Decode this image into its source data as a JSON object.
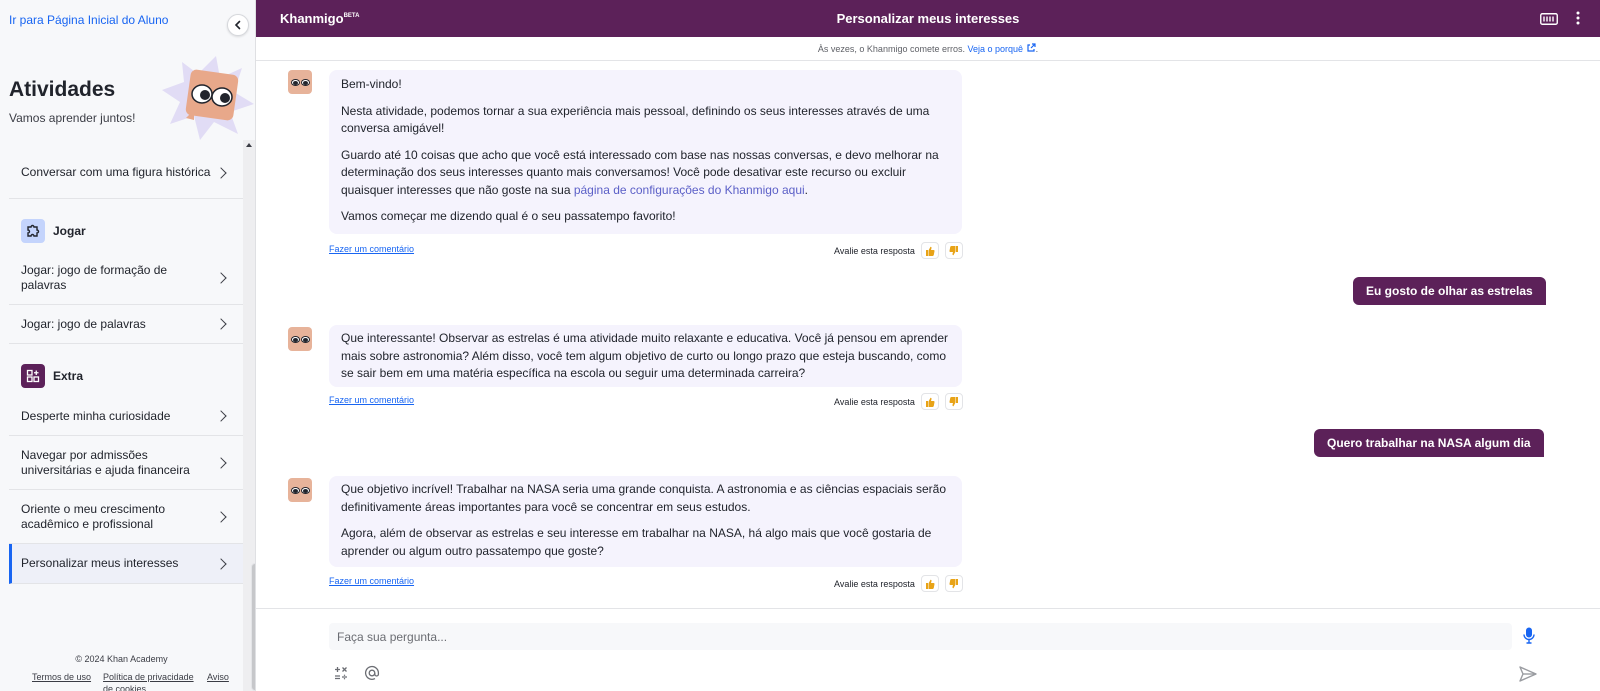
{
  "sidebar": {
    "back_link": "Ir para Página Inicial do Aluno",
    "title": "Atividades",
    "subtitle": "Vamos aprender juntos!",
    "items": [
      {
        "label": "Conversar com uma figura histórica"
      },
      {
        "label": "Jogar: jogo de formação de palavras"
      },
      {
        "label": "Jogar: jogo de palavras"
      },
      {
        "label": "Desperte minha curiosidade"
      },
      {
        "label": "Navegar por admissões universitárias e ajuda financeira"
      },
      {
        "label": "Oriente o meu crescimento acadêmico e profissional"
      },
      {
        "label": "Personalizar meus interesses",
        "active": true
      }
    ],
    "sections": {
      "play": "Jogar",
      "extra": "Extra"
    },
    "footer": {
      "copyright": "© 2024 Khan Academy",
      "terms": "Termos de uso",
      "privacy": "Política de privacidade de cookies",
      "notice": "Aviso"
    }
  },
  "header": {
    "brand": "Khanmigo",
    "brand_badge": "BETA",
    "title": "Personalizar meus interesses"
  },
  "disclaimer": {
    "text": "Às vezes, o Khanmigo comete erros.",
    "link": "Veja o porquê",
    "end": "."
  },
  "chat": {
    "feedback_link": "Fazer um comentário",
    "rate_label": "Avalie esta resposta",
    "messages": [
      {
        "role": "bot",
        "paragraphs": [
          "Bem-vindo!",
          "Nesta atividade, podemos tornar a sua experiência mais pessoal, definindo os seus interesses através de uma conversa amigável!",
          "Guardo até 10 coisas que acho que você está interessado com base nas nossas conversas, e devo melhorar na determinação dos seus interesses quanto mais conversamos! Você pode desativar este recurso ou excluir quaisquer interesses que não goste na sua ",
          "Vamos começar me dizendo qual é o seu passatempo favorito!"
        ],
        "link": "página de configurações do Khanmigo aqui",
        "link_end": "."
      },
      {
        "role": "user",
        "text": "Eu gosto de olhar as estrelas"
      },
      {
        "role": "bot",
        "paragraphs": [
          "Que interessante! Observar as estrelas é uma atividade muito relaxante e educativa. Você já pensou em aprender mais sobre astronomia? Além disso, você tem algum objetivo de curto ou longo prazo que esteja buscando, como se sair bem em uma matéria específica na escola ou seguir uma determinada carreira?"
        ]
      },
      {
        "role": "user",
        "text": "Quero trabalhar na NASA algum dia"
      },
      {
        "role": "bot",
        "paragraphs": [
          "Que objetivo incrível! Trabalhar na NASA seria uma grande conquista. A astronomia e as ciências espaciais serão definitivamente áreas importantes para você se concentrar em seus estudos.",
          "Agora, além de observar as estrelas e seu interesse em trabalhar na NASA, há algo mais que você gostaria de aprender ou algum outro passatempo que goste?"
        ]
      }
    ]
  },
  "input": {
    "placeholder": "Faça sua pergunta..."
  },
  "colors": {
    "header": "#5c2159",
    "user_bubble": "#5c2159",
    "bot_bubble": "#f5f3fd",
    "link": "#1865f2",
    "thumb": "#e8a317"
  }
}
